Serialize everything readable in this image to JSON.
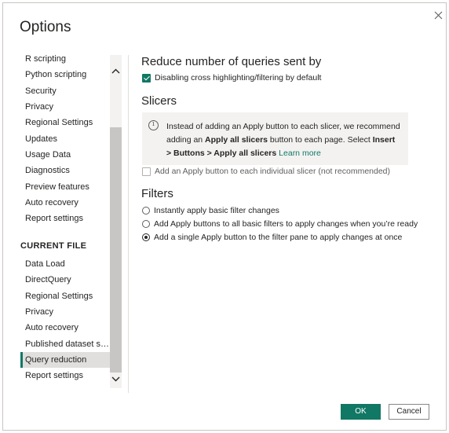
{
  "dialog": {
    "title": "Options",
    "ok_label": "OK",
    "cancel_label": "Cancel"
  },
  "sidebar": {
    "global_items": [
      {
        "label": "R scripting"
      },
      {
        "label": "Python scripting"
      },
      {
        "label": "Security"
      },
      {
        "label": "Privacy"
      },
      {
        "label": "Regional Settings"
      },
      {
        "label": "Updates"
      },
      {
        "label": "Usage Data"
      },
      {
        "label": "Diagnostics"
      },
      {
        "label": "Preview features"
      },
      {
        "label": "Auto recovery"
      },
      {
        "label": "Report settings"
      }
    ],
    "current_file_header": "CURRENT FILE",
    "current_file_items": [
      {
        "label": "Data Load"
      },
      {
        "label": "DirectQuery"
      },
      {
        "label": "Regional Settings"
      },
      {
        "label": "Privacy"
      },
      {
        "label": "Auto recovery"
      },
      {
        "label": "Published dataset set..."
      },
      {
        "label": "Query reduction",
        "selected": true
      },
      {
        "label": "Report settings"
      }
    ]
  },
  "main": {
    "heading": "Reduce number of queries sent by",
    "cross_highlight": {
      "label": "Disabling cross highlighting/filtering by default",
      "checked": true
    },
    "slicers": {
      "heading": "Slicers",
      "info": {
        "part1": "Instead of adding an Apply button to each slicer, we recommend adding an ",
        "bold1": "Apply all slicers",
        "part2": " button to each page. Select ",
        "bold2": "Insert > Buttons > Apply all slicers",
        "link": "Learn more"
      },
      "apply_each": {
        "label": "Add an Apply button to each individual slicer (not recommended)",
        "checked": false
      }
    },
    "filters": {
      "heading": "Filters",
      "options": [
        {
          "label": "Instantly apply basic filter changes",
          "selected": false
        },
        {
          "label": "Add Apply buttons to all basic filters to apply changes when you’re ready",
          "selected": false
        },
        {
          "label": "Add a single Apply button to the filter pane to apply changes at once",
          "selected": true
        }
      ]
    }
  },
  "colors": {
    "accent": "#117865",
    "selected_bg": "#e1dfdd",
    "info_bg": "#f3f2f1"
  }
}
